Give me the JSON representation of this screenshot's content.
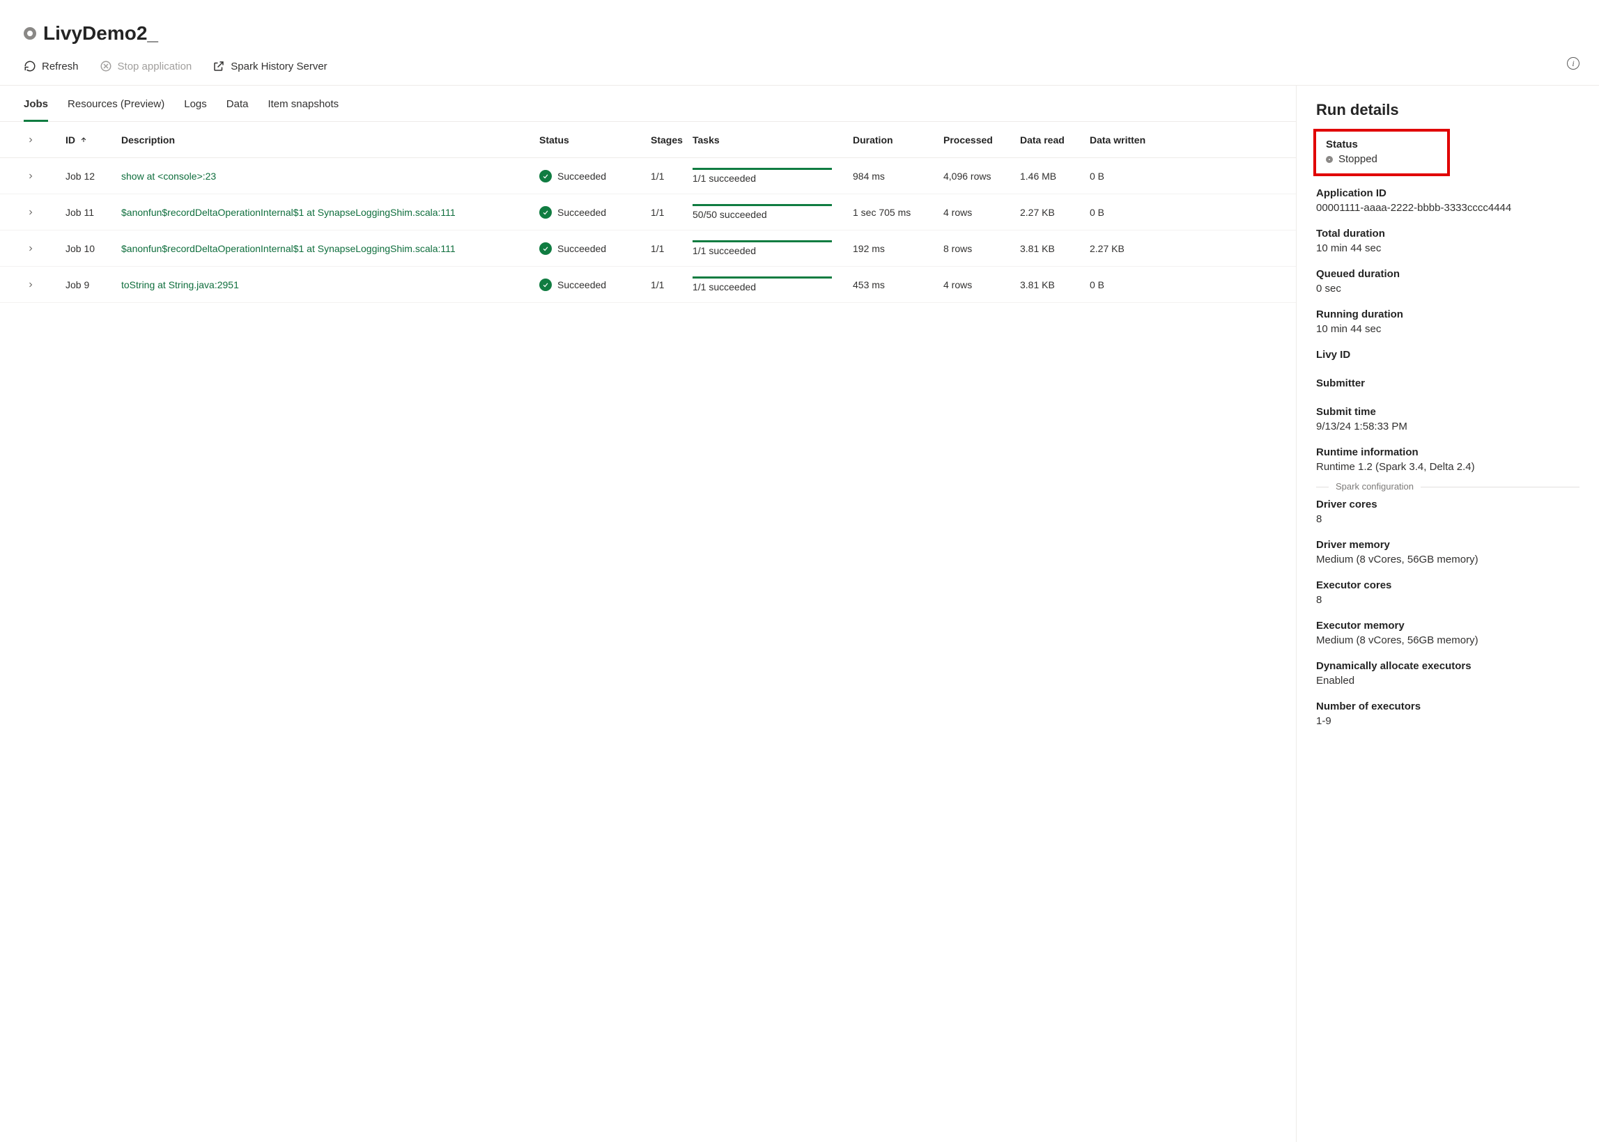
{
  "header": {
    "title": "LivyDemo2_"
  },
  "toolbar": {
    "refresh": "Refresh",
    "stop": "Stop application",
    "history": "Spark History Server"
  },
  "tabs": [
    "Jobs",
    "Resources (Preview)",
    "Logs",
    "Data",
    "Item snapshots"
  ],
  "columns": {
    "id": "ID",
    "description": "Description",
    "status": "Status",
    "stages": "Stages",
    "tasks": "Tasks",
    "duration": "Duration",
    "processed": "Processed",
    "dataRead": "Data read",
    "dataWritten": "Data written"
  },
  "jobs": [
    {
      "id": "Job 12",
      "desc": "show at <console>:23",
      "status": "Succeeded",
      "stages": "1/1",
      "tasks": "1/1 succeeded",
      "duration": "984 ms",
      "processed": "4,096 rows",
      "read": "1.46 MB",
      "written": "0 B"
    },
    {
      "id": "Job 11",
      "desc": "$anonfun$recordDeltaOperationInternal$1 at SynapseLoggingShim.scala:111",
      "status": "Succeeded",
      "stages": "1/1",
      "tasks": "50/50 succeeded",
      "duration": "1 sec 705 ms",
      "processed": "4 rows",
      "read": "2.27 KB",
      "written": "0 B"
    },
    {
      "id": "Job 10",
      "desc": "$anonfun$recordDeltaOperationInternal$1 at SynapseLoggingShim.scala:111",
      "status": "Succeeded",
      "stages": "1/1",
      "tasks": "1/1 succeeded",
      "duration": "192 ms",
      "processed": "8 rows",
      "read": "3.81 KB",
      "written": "2.27 KB"
    },
    {
      "id": "Job 9",
      "desc": "toString at String.java:2951",
      "status": "Succeeded",
      "stages": "1/1",
      "tasks": "1/1 succeeded",
      "duration": "453 ms",
      "processed": "4 rows",
      "read": "3.81 KB",
      "written": "0 B"
    }
  ],
  "runDetails": {
    "title": "Run details",
    "statusLabel": "Status",
    "statusValue": "Stopped",
    "appIdLabel": "Application ID",
    "appId": "00001111-aaaa-2222-bbbb-3333cccc4444",
    "totalDurationLabel": "Total duration",
    "totalDuration": "10 min 44 sec",
    "queuedLabel": "Queued duration",
    "queued": "0 sec",
    "runningLabel": "Running duration",
    "running": "10 min 44 sec",
    "livyLabel": "Livy ID",
    "livy": "",
    "submitterLabel": "Submitter",
    "submitter": "",
    "submitTimeLabel": "Submit time",
    "submitTime": "9/13/24 1:58:33 PM",
    "runtimeLabel": "Runtime information",
    "runtime": "Runtime 1.2 (Spark 3.4, Delta 2.4)",
    "sparkConfig": "Spark configuration",
    "driverCoresLabel": "Driver cores",
    "driverCores": "8",
    "driverMemLabel": "Driver memory",
    "driverMem": "Medium (8 vCores, 56GB memory)",
    "execCoresLabel": "Executor cores",
    "execCores": "8",
    "execMemLabel": "Executor memory",
    "execMem": "Medium (8 vCores, 56GB memory)",
    "dynAllocLabel": "Dynamically allocate executors",
    "dynAlloc": "Enabled",
    "numExecLabel": "Number of executors",
    "numExec": "1-9"
  }
}
